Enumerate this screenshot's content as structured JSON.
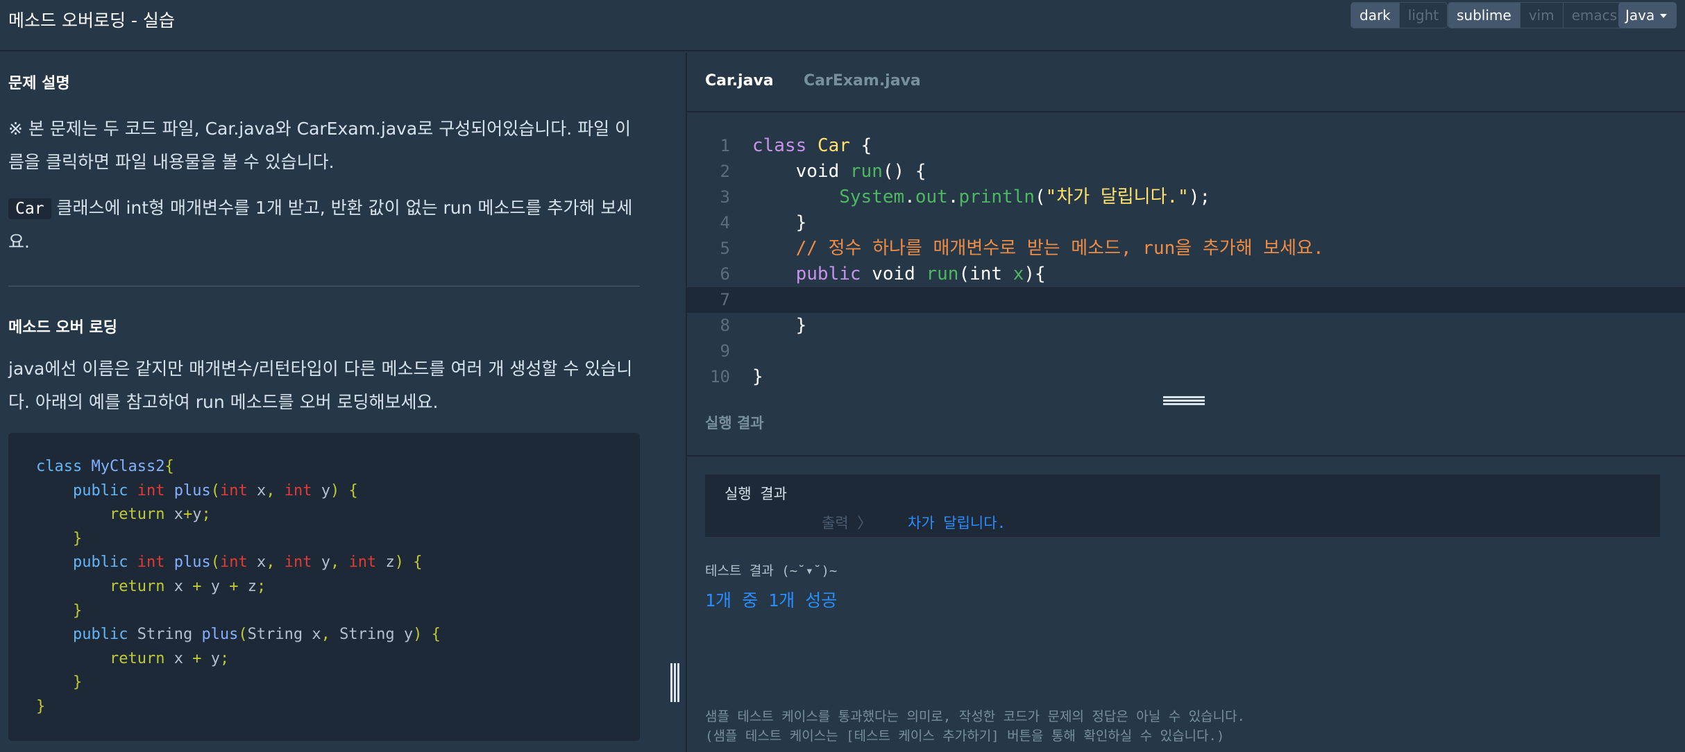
{
  "header": {
    "title": "메소드 오버로딩 - 실습",
    "theme_options": [
      "dark",
      "light"
    ],
    "keymap_options": [
      "sublime",
      "vim",
      "emacs"
    ],
    "language": "Java"
  },
  "problem": {
    "section1_title": "문제 설명",
    "intro": "※ 본 문제는 두 코드 파일, Car.java와 CarExam.java로 구성되어있습니다. 파일 이름을 클릭하면 파일 내용물을 볼 수 있습니다.",
    "task_code": "Car",
    "task_text": "클래스에 int형 매개변수를 1개 받고, 반환 값이 없는 run 메소드를 추가해 보세요.",
    "section2_title": "메소드 오버 로딩",
    "overload_desc": "java에선 이름은 같지만 매개변수/리턴타입이 다른 메소드를 여러 개 생성할 수 있습니다. 아래의 예를 참고하여 run 메소드를 오버 로딩해보세요."
  },
  "example_code": [
    "class MyClass2{",
    "    public int plus(int x, int y) {",
    "        return x+y;",
    "    }",
    "    public int plus(int x, int y, int z) {",
    "        return x + y + z;",
    "    }",
    "    public String plus(String x, String y) {",
    "        return x + y;",
    "    }",
    "}"
  ],
  "editor": {
    "tabs": [
      "Car.java",
      "CarExam.java"
    ],
    "active_tab": "Car.java",
    "line_numbers": [
      "1",
      "2",
      "3",
      "4",
      "5",
      "6",
      "7",
      "8",
      "9",
      "10"
    ],
    "lines": [
      "class Car {",
      "    void run() {",
      "        System.out.println(\"차가 달립니다.\");",
      "    }",
      "    // 정수 하나를 매개변수로 받는 메소드, run을 추가해 보세요.",
      "    public void run(int x){",
      "",
      "    }",
      "",
      "}"
    ]
  },
  "result": {
    "header": "실행 결과",
    "run_label": "실행 결과",
    "output_label": "출력 〉",
    "output_value": "차가 달립니다.",
    "test_title": "테스트 결과 (~˘▾˘)~",
    "test_pass": "1개 중 1개 성공",
    "note1": "샘플 테스트 케이스를 통과했다는 의미로, 작성한 코드가 문제의 정답은 아닐 수 있습니다.",
    "note2": "(샘플 테스트 케이스는 [테스트 케이스 추가하기] 버튼을 통해 확인하실 수 있습니다.)"
  }
}
